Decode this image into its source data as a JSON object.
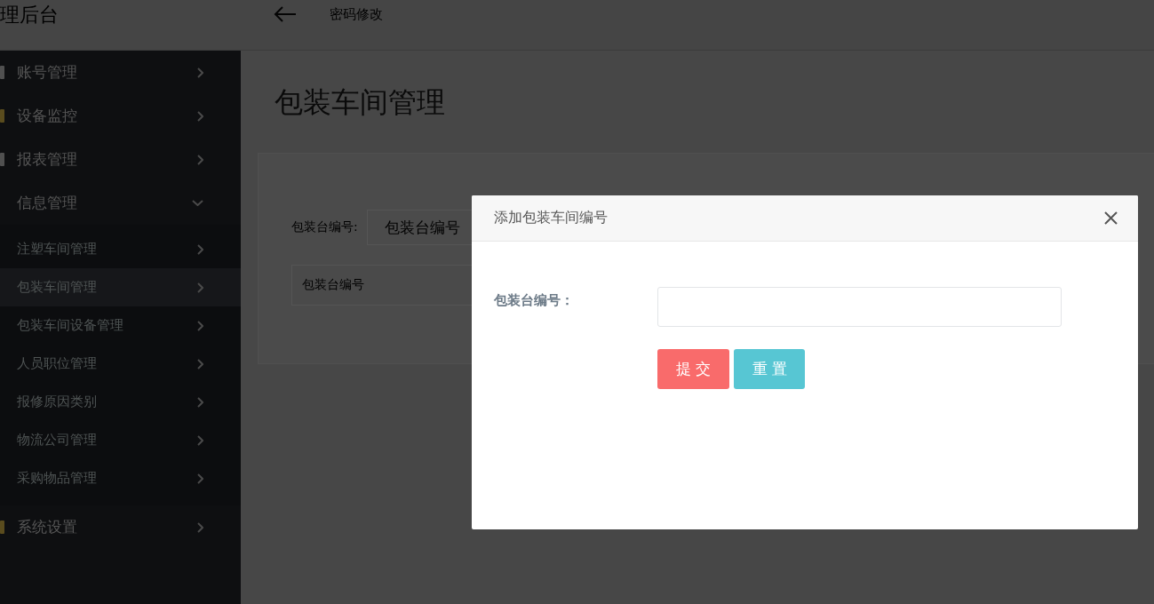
{
  "header": {
    "title": "理后台",
    "link": "密码修改"
  },
  "sidebar": {
    "items": [
      {
        "label": "账号管理",
        "color": "#505050",
        "expanded": false
      },
      {
        "label": "设备监控",
        "color": "#5a4c1e",
        "expanded": false
      },
      {
        "label": "报表管理",
        "color": "#505050",
        "expanded": false
      },
      {
        "label": "信息管理",
        "expanded": true,
        "children": [
          {
            "label": "注塑车间管理",
            "selected": false
          },
          {
            "label": "包装车间管理",
            "selected": true
          },
          {
            "label": "包装车间设备管理",
            "selected": false
          },
          {
            "label": "人员职位管理",
            "selected": false
          },
          {
            "label": "报修原因类别",
            "selected": false
          },
          {
            "label": "物流公司管理",
            "selected": false
          },
          {
            "label": "采购物品管理",
            "selected": false
          }
        ]
      },
      {
        "label": "系统设置",
        "color": "#5a4c1e",
        "expanded": false
      }
    ]
  },
  "page": {
    "title": "包装车间管理",
    "filter": {
      "label": "包装台编号:",
      "placeholder": "包装台编号"
    },
    "table": {
      "columns": [
        "包装台编号"
      ]
    }
  },
  "modal": {
    "title": "添加包装车间编号",
    "field": {
      "label": "包装台编号："
    },
    "buttons": [
      {
        "label": "提交",
        "kind": "submit"
      },
      {
        "label": "重置",
        "kind": "reset"
      }
    ]
  }
}
